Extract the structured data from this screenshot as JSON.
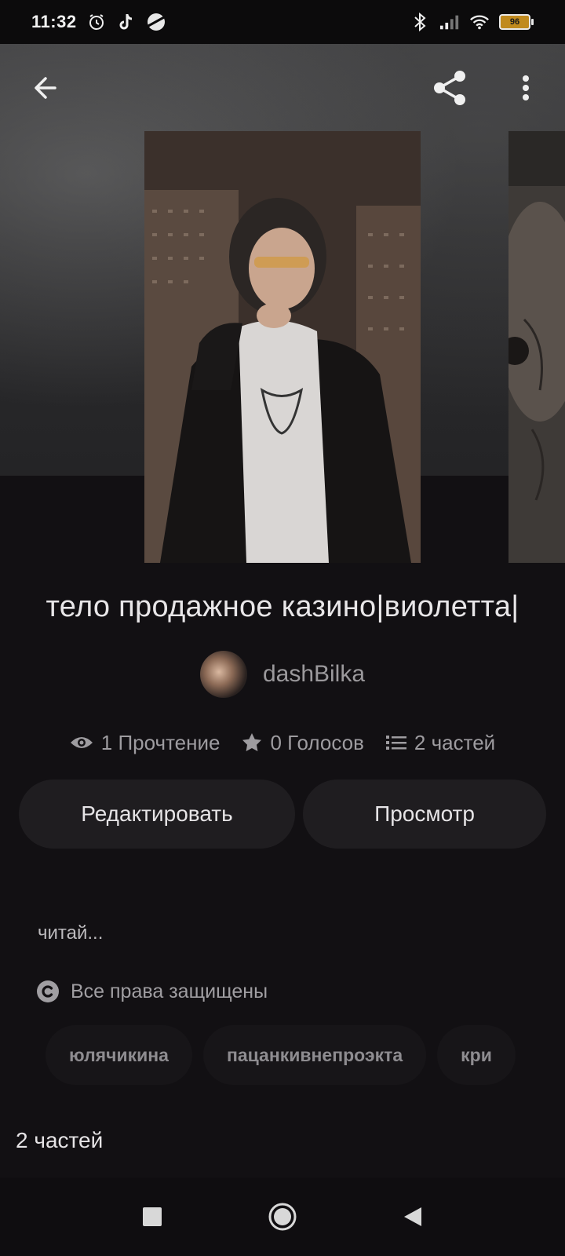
{
  "status_bar": {
    "time": "11:32",
    "icons": [
      "alarm-icon",
      "tiktok-icon",
      "planet-icon",
      "bluetooth-icon",
      "signal-icon",
      "wifi-icon"
    ],
    "battery_level": "96",
    "battery_color": "#c08a1e"
  },
  "top_bar": {
    "back_icon": "arrow-left-icon",
    "share_icon": "share-icon",
    "more_icon": "more-vertical-icon"
  },
  "story": {
    "title": "тело продажное казино|виолетта|",
    "author": "dashBilka"
  },
  "stats": {
    "reads": "1 Прочтение",
    "votes": "0 Голосов",
    "parts": "2 частей"
  },
  "actions": {
    "edit_label": "Редактировать",
    "view_label": "Просмотр"
  },
  "description": "читай...",
  "copyright_text": "Все права защищены",
  "tags": [
    "юлячикина",
    "пацанкивнепроэкта",
    "кри"
  ],
  "parts_heading": "2 частей",
  "nav": {
    "recents_icon": "square-icon",
    "home_icon": "circle-icon",
    "back_icon": "triangle-back-icon"
  }
}
